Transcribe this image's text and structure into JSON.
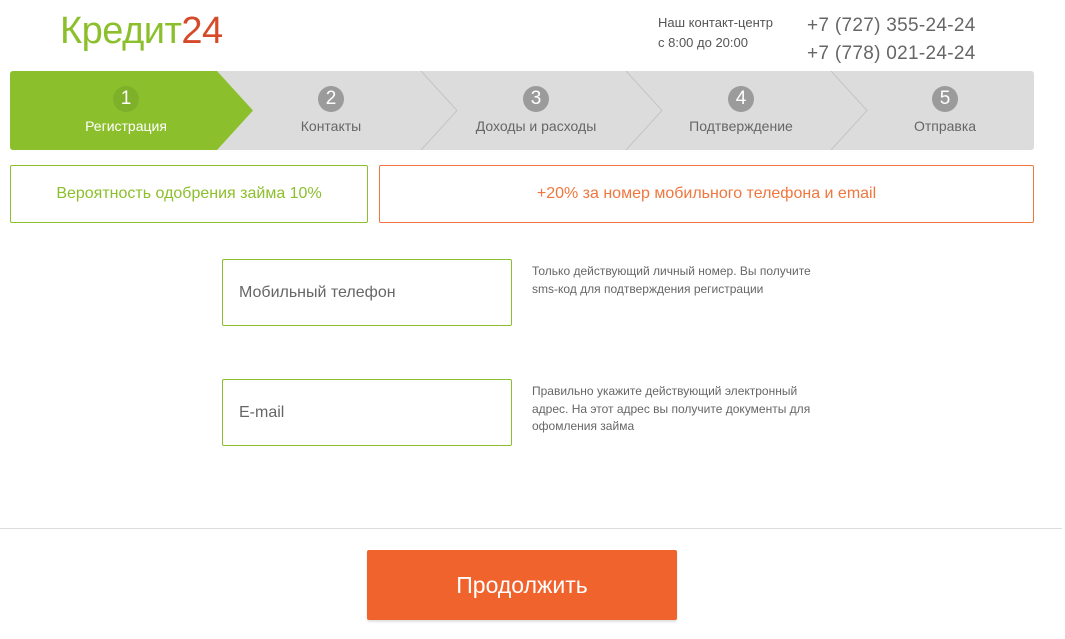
{
  "header": {
    "logo_part1": "Кредит",
    "logo_part2": "24",
    "contact_line1": "Наш контакт-центр",
    "contact_line2": "с 8:00 до 20:00",
    "phone1": "+7 (727) 355-24-24",
    "phone2": "+7 (778) 021-24-24"
  },
  "steps": [
    {
      "num": "1",
      "label": "Регистрация",
      "active": true
    },
    {
      "num": "2",
      "label": "Контакты",
      "active": false
    },
    {
      "num": "3",
      "label": "Доходы и расходы",
      "active": false
    },
    {
      "num": "4",
      "label": "Подтверждение",
      "active": false
    },
    {
      "num": "5",
      "label": "Отправка",
      "active": false
    }
  ],
  "info": {
    "approval": "Вероятность одобрения займа 10%",
    "bonus": "+20% за номер мобильного телефона и email"
  },
  "form": {
    "phone_placeholder": "Мобильный телефон",
    "phone_value": "",
    "phone_hint": "Только действующий личный номер. Вы получите sms-код для подтверждения регистрации",
    "email_placeholder": "E-mail",
    "email_value": "",
    "email_hint": "Правильно укажите действующий электронный адрес. На этот адрес вы получите документы для офомления займа"
  },
  "actions": {
    "continue_label": "Продолжить"
  },
  "colors": {
    "brand_green": "#8cbf2c",
    "brand_orange": "#f0632d",
    "steps_bg": "#dcdcdc"
  }
}
